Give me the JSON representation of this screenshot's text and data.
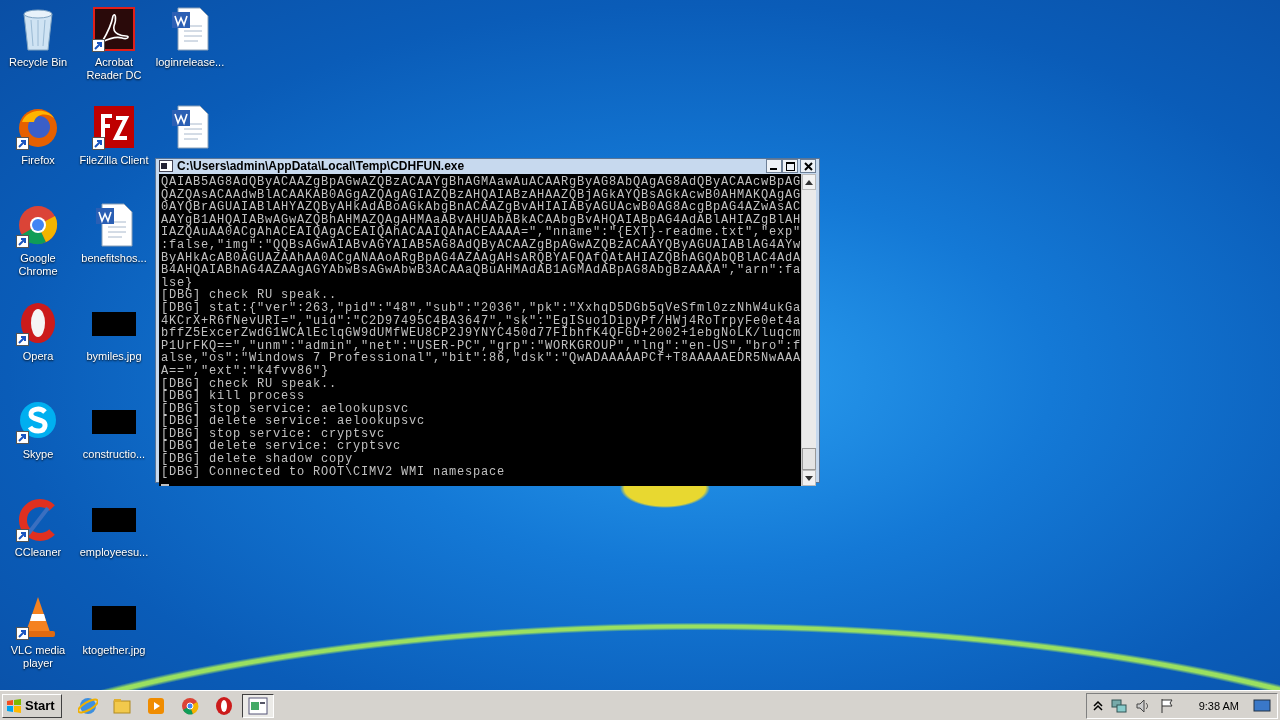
{
  "desktop_icons": [
    {
      "label": "Recycle Bin",
      "kind": "app",
      "shortcut": false
    },
    {
      "label": "Firefox",
      "kind": "app",
      "shortcut": true
    },
    {
      "label": "Google Chrome",
      "kind": "app",
      "shortcut": true
    },
    {
      "label": "Opera",
      "kind": "app",
      "shortcut": true
    },
    {
      "label": "Skype",
      "kind": "app",
      "shortcut": true
    },
    {
      "label": "CCleaner",
      "kind": "app",
      "shortcut": true
    },
    {
      "label": "VLC media player",
      "kind": "app",
      "shortcut": true
    },
    {
      "label": "Acrobat Reader DC",
      "kind": "app",
      "shortcut": true
    },
    {
      "label": "FileZilla Client",
      "kind": "app",
      "shortcut": true
    },
    {
      "label": "benefitshos...",
      "kind": "document",
      "shortcut": false
    },
    {
      "label": "bymiles.jpg",
      "kind": "image",
      "shortcut": false
    },
    {
      "label": "constructio...",
      "kind": "image",
      "shortcut": false
    },
    {
      "label": "employeesu...",
      "kind": "image",
      "shortcut": false
    },
    {
      "label": "ktogether.jpg",
      "kind": "image",
      "shortcut": false
    },
    {
      "label": "loginrelease...",
      "kind": "document",
      "shortcut": false
    },
    {
      "kind": "document",
      "shortcut": false
    }
  ],
  "console_window": {
    "title": "C:\\Users\\admin\\AppData\\Local\\Temp\\CDHFUN.exe",
    "lines": [
      "QAIAB5AG8AdQByACAAZgBpAGwAZQBzACAAYgBhAGMAawAuACAARgByAG8AbQAgAG8AdQByACAAcwBpAG",
      "QAZQAsACAAdwBlACAAKAB0AGgAZQAgAGIAZQBzAHQAIABzAHAAZQBjAGkAYQBsAGkAcwB0AHMAKQAgAG",
      "0AYQBrAGUAIABlAHYAZQByAHkAdABoAGkAbgBnACAAZgBvAHIAIAByAGUAcwB0AG8AcgBpAG4AZwAsAC",
      "AAYgB1AHQAIABwAGwAZQBhAHMAZQAgAHMAaABvAHUAbABkACAAbgBvAHQAIABpAG4AdABlAHIAZgBlAH",
      "IAZQAuAA0ACgAhACEAIQAgACEAIQAhACAAIQAhACEAAAA=\",\"nname\":\"{EXT}-readme.txt\",\"exp\"",
      ":false,\"img\":\"QQBsAGwAIABvAGYAIAB5AG8AdQByACAAZgBpAGwAZQBzACAAYQByAGUAIABlAG4AYw",
      "ByAHkAcAB0AGUAZAAhAA0ACgANAAoARgBpAG4AZAAgAHsARQBYAFQAfQAtAHIAZQBhAGQAbQBlAC4AdA",
      "B4AHQAIABhAG4AZAAgAGYAbwBsAGwAbwB3ACAAaQBuAHMAdAB1AGMAdABpAG8AbgBzAAAA\",\"arn\":fa",
      "lse}",
      "[DBG] check RU speak..",
      "[DBG] stat:{\"ver\":263,\"pid\":\"48\",\"sub\":\"2036\",\"pk\":\"XxhqD5DGb5qVeSfml0zzNhW4ukGa",
      "4KCrX+R6fNevURI=\",\"uid\":\"C2D97495C4BA3647\",\"sk\":\"EgISuo1DipyPf/HWj4RoTrpyFe0et4a",
      "bffZ5ExcerZwdG1WCAlEclqGW9dUMfWEU8CP2J9YNYC450d77FIbhfK4QFGD+2002+1ebgNoLK/luqcm",
      "P1UrFKQ==\",\"unm\":\"admin\",\"net\":\"USER-PC\",\"grp\":\"WORKGROUP\",\"lng\":\"en-US\",\"bro\":f",
      "alse,\"os\":\"Windows 7 Professional\",\"bit\":86,\"dsk\":\"QwADAAAAAPCf+T8AAAAAEDR5NwAAA",
      "A==\",\"ext\":\"k4fvv86\"}",
      "[DBG] check RU speak..",
      "[DBG] kill process",
      "[DBG] stop service: aelookupsvc",
      "[DBG] delete service: aelookupsvc",
      "[DBG] stop service: cryptsvc",
      "[DBG] delete service: cryptsvc",
      "[DBG] delete shadow copy",
      "[DBG] Connected to ROOT\\CIMV2 WMI namespace"
    ]
  },
  "taskbar": {
    "start": "Start",
    "items": [
      {
        "active": false
      },
      {
        "active": false
      },
      {
        "active": false
      },
      {
        "active": false
      },
      {
        "active": false
      },
      {
        "active": true
      }
    ],
    "clock": "9:38 AM"
  }
}
